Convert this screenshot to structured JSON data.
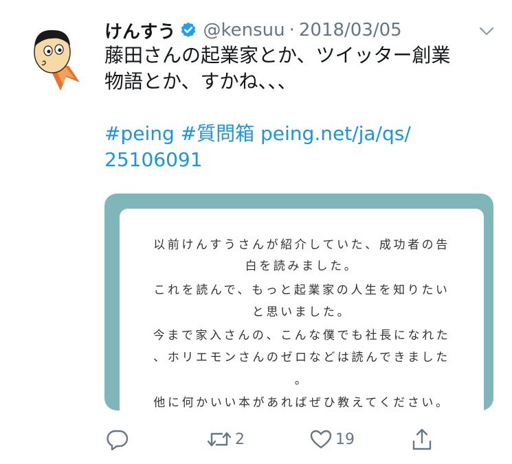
{
  "tweet": {
    "display_name": "けんすう",
    "handle": "@kensuu",
    "separator": "·",
    "date": "2018/03/05",
    "text_lines": [
      "藤田さんの起業家とか、ツイッター創業",
      "物語とか、すかね、、、"
    ],
    "link_lines": [
      "#peing #質問箱 peing.net/ja/qs/",
      "25106091"
    ],
    "verified_icon": "verified-badge-icon",
    "caret_icon": "chevron-down-icon"
  },
  "card": {
    "background_color": "#7fb6b9",
    "question_lines": [
      "以前けんすうさんが紹介していた、成功者の告",
      "白を読みました。",
      "これを読んで、もっと起業家の人生を知りたい",
      "と思いました。",
      "今まで家入さんの、こんな僕でも社長になれた",
      "、ホリエモンさんのゼロなどは読んできました",
      "。",
      "他に何かいい本があればぜひ教えてください。"
    ]
  },
  "actions": {
    "reply_icon": "reply-icon",
    "retweet_icon": "retweet-icon",
    "retweet_count": "2",
    "like_icon": "heart-icon",
    "like_count": "19",
    "share_icon": "share-icon"
  },
  "colors": {
    "link": "#1b95e0",
    "secondary_text": "#657786",
    "verified": "#1da1f2"
  }
}
